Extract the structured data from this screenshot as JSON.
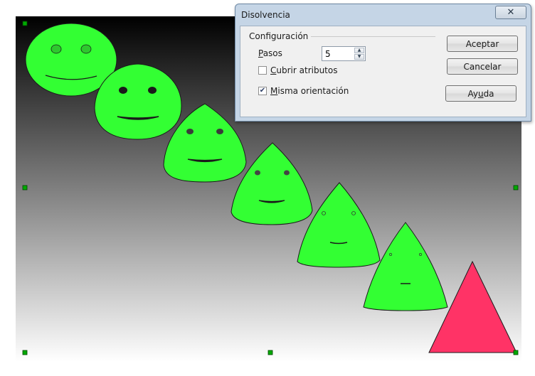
{
  "dialog": {
    "title": "Disolvencia",
    "close_glyph": "✕",
    "group_label": "Configuración",
    "steps": {
      "label_prefix": "",
      "label_accel": "P",
      "label_rest": "asos",
      "value": "5"
    },
    "cover_attributes": {
      "accel": "C",
      "rest": "ubrir atributos",
      "checked": false
    },
    "same_orientation": {
      "accel": "M",
      "rest": "isma orientación",
      "checked": true
    },
    "buttons": {
      "accept": "Aceptar",
      "cancel": "Cancelar",
      "help_prefix": "Ay",
      "help_accel": "u",
      "help_rest": "da"
    }
  },
  "canvas": {
    "gradient_top": "#000000",
    "gradient_bottom": "#ffffff",
    "morph_fill": "#33ff33",
    "triangle_fill": "#ff3366",
    "handle_color": "#00aa00"
  }
}
